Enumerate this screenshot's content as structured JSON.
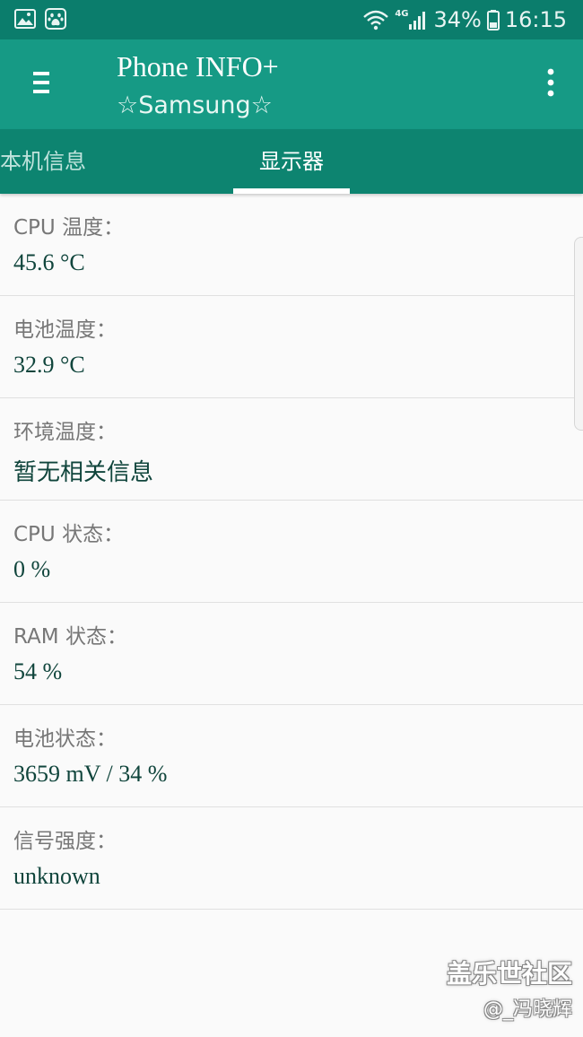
{
  "status_bar": {
    "battery_percent": "34%",
    "time": "16:15",
    "network_type": "4G",
    "icons": [
      "gallery-notification-icon",
      "baidu-notification-icon",
      "wifi-icon",
      "signal-icon",
      "battery-icon"
    ]
  },
  "app_bar": {
    "title": "Phone INFO+",
    "subtitle": "☆Samsung☆",
    "icons": [
      "hamburger-menu-icon",
      "overflow-menu-icon"
    ]
  },
  "tabs": [
    {
      "label": "本机信息",
      "selected": false
    },
    {
      "label": "显示器",
      "selected": true
    }
  ],
  "info": [
    {
      "label": "CPU 温度：",
      "value": "45.6 °C"
    },
    {
      "label": "电池温度：",
      "value": "32.9 °C"
    },
    {
      "label": "环境温度：",
      "value": "暂无相关信息"
    },
    {
      "label": "CPU 状态：",
      "value": "0 %"
    },
    {
      "label": "RAM 状态：",
      "value": "54 %"
    },
    {
      "label": "电池状态：",
      "value": "3659 mV / 34 %"
    },
    {
      "label": "信号强度：",
      "value": "unknown"
    }
  ],
  "watermark": {
    "line1": "盖乐世社区",
    "line2": "@_冯晓辉"
  },
  "colors": {
    "status_bar": "#0b7d6c",
    "app_bar": "#169a85",
    "tab_bar": "#0d8470",
    "value_text": "#10453c",
    "label_text": "#777777",
    "background": "#fafafa"
  }
}
